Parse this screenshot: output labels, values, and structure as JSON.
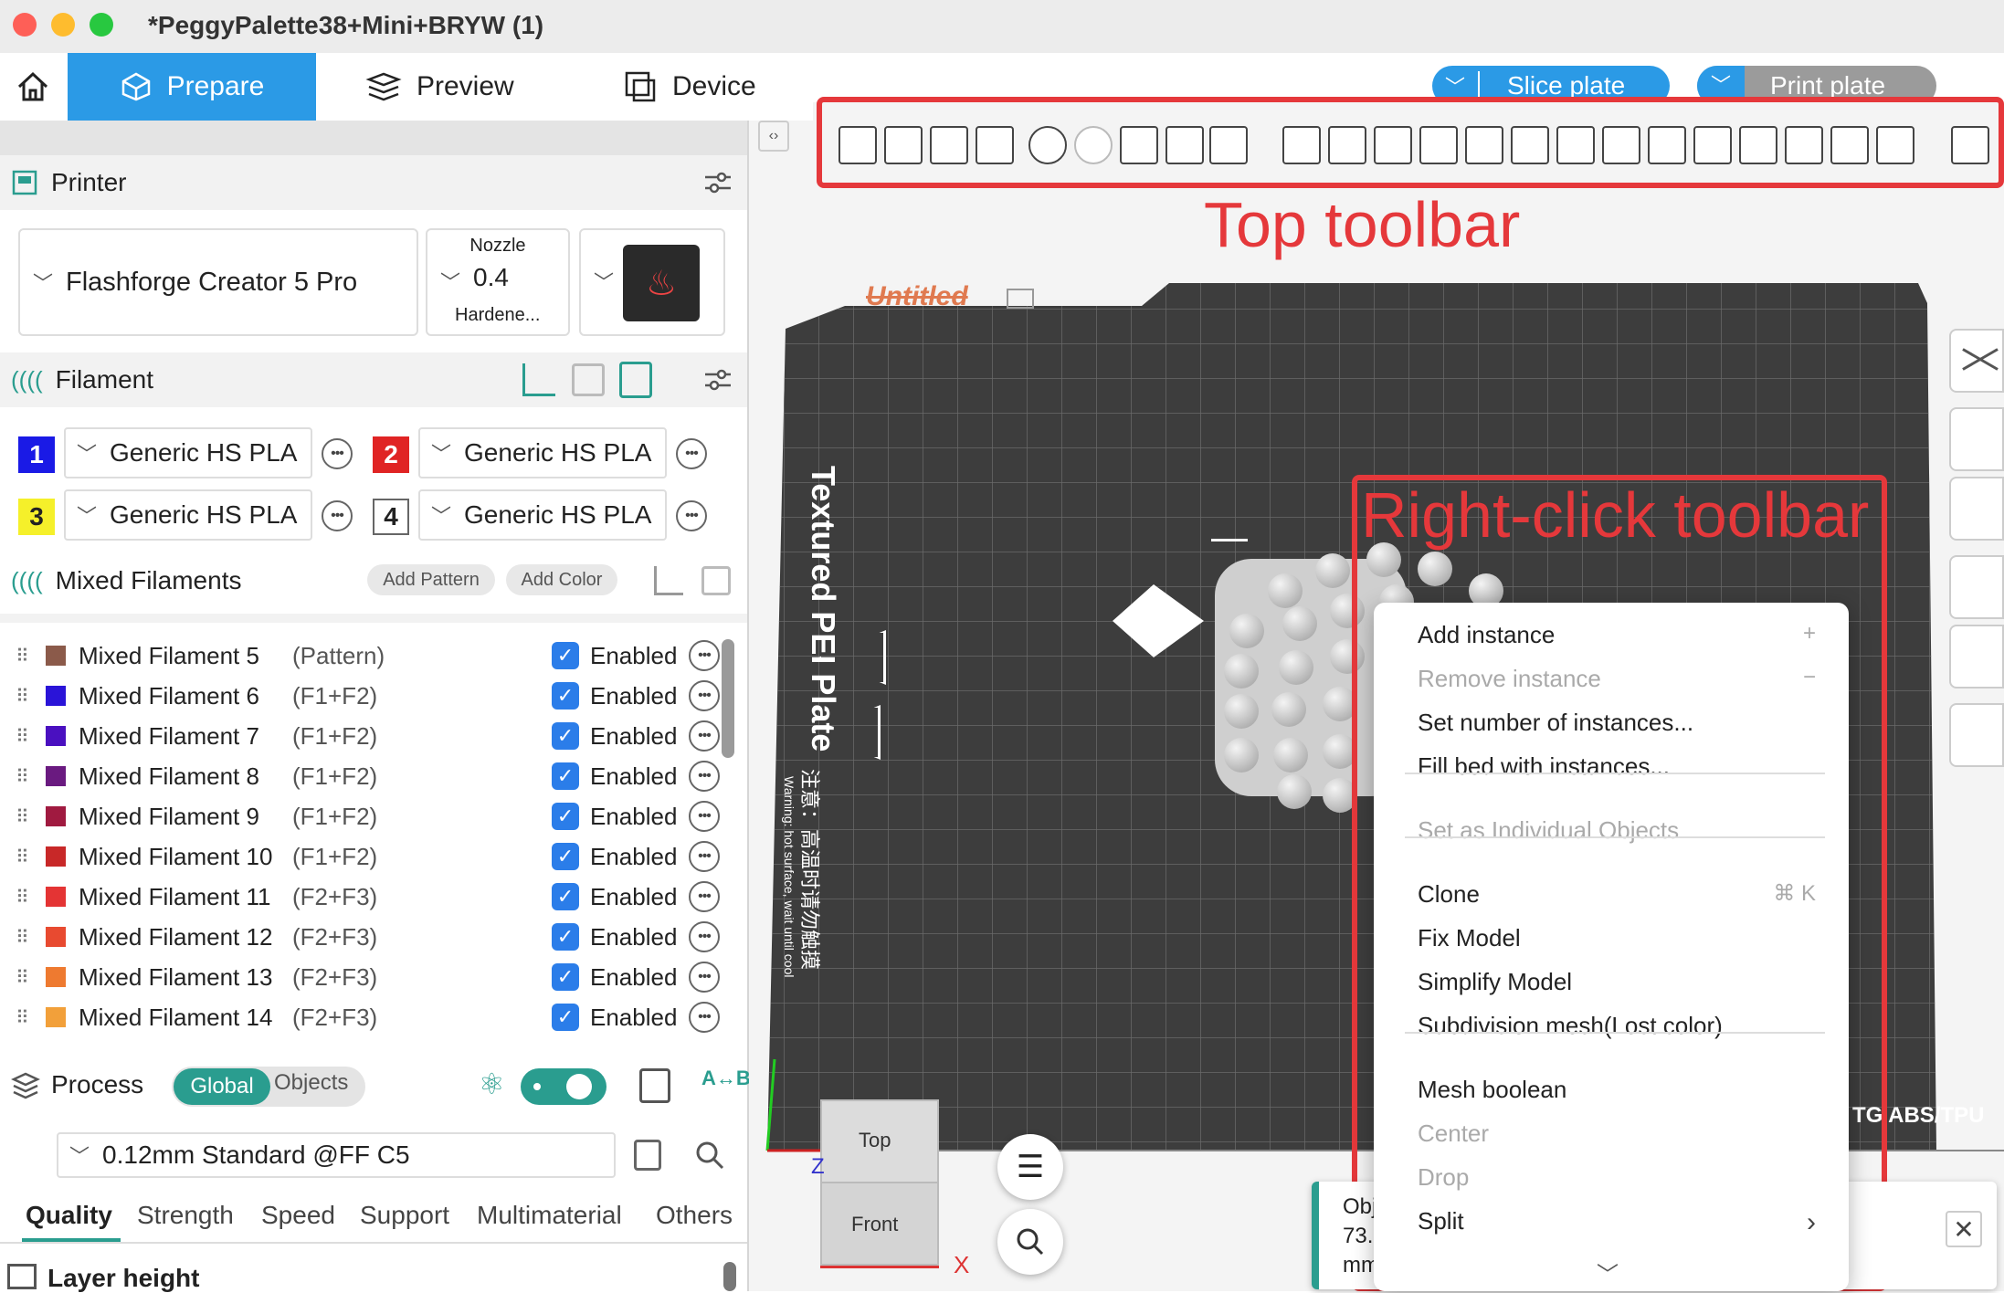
{
  "window": {
    "title": "*PeggyPalette38+Mini+BRYW (1)"
  },
  "nav": {
    "tabs": [
      {
        "label": "Prepare"
      },
      {
        "label": "Preview"
      },
      {
        "label": "Device"
      }
    ],
    "slice": "Slice plate",
    "print": "Print plate"
  },
  "printer": {
    "section": "Printer",
    "name": "Flashforge Creator 5 Pro",
    "nozzle_label": "Nozzle",
    "nozzle_value": "0.4",
    "nozzle_type": "Hardene..."
  },
  "filament": {
    "section": "Filament",
    "items": [
      {
        "num": "1",
        "name": "Generic HS PLA",
        "color": "#1a1ae6",
        "text": "#fff"
      },
      {
        "num": "2",
        "name": "Generic HS PLA",
        "color": "#e02424",
        "text": "#fff"
      },
      {
        "num": "3",
        "name": "Generic HS PLA",
        "color": "#f5f02a",
        "text": "#222"
      },
      {
        "num": "4",
        "name": "Generic HS PLA",
        "color": "#ffffff",
        "text": "#222"
      }
    ]
  },
  "mixed": {
    "section": "Mixed Filaments",
    "add_pattern": "Add Pattern",
    "add_color": "Add Color",
    "enabled": "Enabled",
    "items": [
      {
        "name": "Mixed Filament 5",
        "tag": "(Pattern)",
        "color": "#8b5a4a"
      },
      {
        "name": "Mixed Filament 6",
        "tag": "(F1+F2)",
        "color": "#2a14d8"
      },
      {
        "name": "Mixed Filament 7",
        "tag": "(F1+F2)",
        "color": "#4a10c0"
      },
      {
        "name": "Mixed Filament 8",
        "tag": "(F1+F2)",
        "color": "#6a1a80"
      },
      {
        "name": "Mixed Filament 9",
        "tag": "(F1+F2)",
        "color": "#a01a40"
      },
      {
        "name": "Mixed Filament 10",
        "tag": "(F1+F2)",
        "color": "#c82828"
      },
      {
        "name": "Mixed Filament 11",
        "tag": "(F2+F3)",
        "color": "#e43434"
      },
      {
        "name": "Mixed Filament 12",
        "tag": "(F2+F3)",
        "color": "#e84a30"
      },
      {
        "name": "Mixed Filament 13",
        "tag": "(F2+F3)",
        "color": "#ee7a30"
      },
      {
        "name": "Mixed Filament 14",
        "tag": "(F2+F3)",
        "color": "#f2a03a"
      }
    ]
  },
  "process": {
    "section": "Process",
    "global": "Global",
    "objects": "Objects",
    "preset": "0.12mm Standard @FF C5",
    "tabs": [
      "Quality",
      "Strength",
      "Speed",
      "Support",
      "Multimaterial",
      "Others"
    ],
    "layer_height": "Layer height"
  },
  "annotations": {
    "top_toolbar": "Top toolbar",
    "right_click": "Right-click toolbar"
  },
  "plate": {
    "name": "Untitled",
    "bed_label": "Textured PEI Plate",
    "warning_cn": "注意：高温时请勿触摸",
    "warning_en": "Warning: hot surface, wait until cool",
    "material_text": "TG ABS/TPU"
  },
  "viewcube": {
    "top": "Top",
    "front": "Front",
    "x": "X",
    "z": "Z"
  },
  "notification": {
    "lines": [
      "Obj",
      "73.",
      "mm"
    ]
  },
  "context_menu": {
    "items": [
      {
        "label": "Add instance",
        "shortcut": "+",
        "disabled": false
      },
      {
        "label": "Remove instance",
        "shortcut": "−",
        "disabled": true
      },
      {
        "label": "Set number of instances...",
        "shortcut": "",
        "disabled": false
      },
      {
        "label": "Fill bed with instances...",
        "shortcut": "",
        "disabled": false
      },
      {
        "label": "Set as Individual Objects",
        "shortcut": "",
        "disabled": true
      },
      {
        "label": "Clone",
        "shortcut": "⌘ K",
        "disabled": false
      },
      {
        "label": "Fix Model",
        "shortcut": "",
        "disabled": false
      },
      {
        "label": "Simplify Model",
        "shortcut": "",
        "disabled": false
      },
      {
        "label": "Subdivision mesh(Lost color)",
        "shortcut": "",
        "disabled": false
      },
      {
        "label": "Mesh boolean",
        "shortcut": "",
        "disabled": false
      },
      {
        "label": "Center",
        "shortcut": "",
        "disabled": true
      },
      {
        "label": "Drop",
        "shortcut": "",
        "disabled": true
      },
      {
        "label": "Split",
        "shortcut": "›",
        "disabled": false
      }
    ]
  }
}
